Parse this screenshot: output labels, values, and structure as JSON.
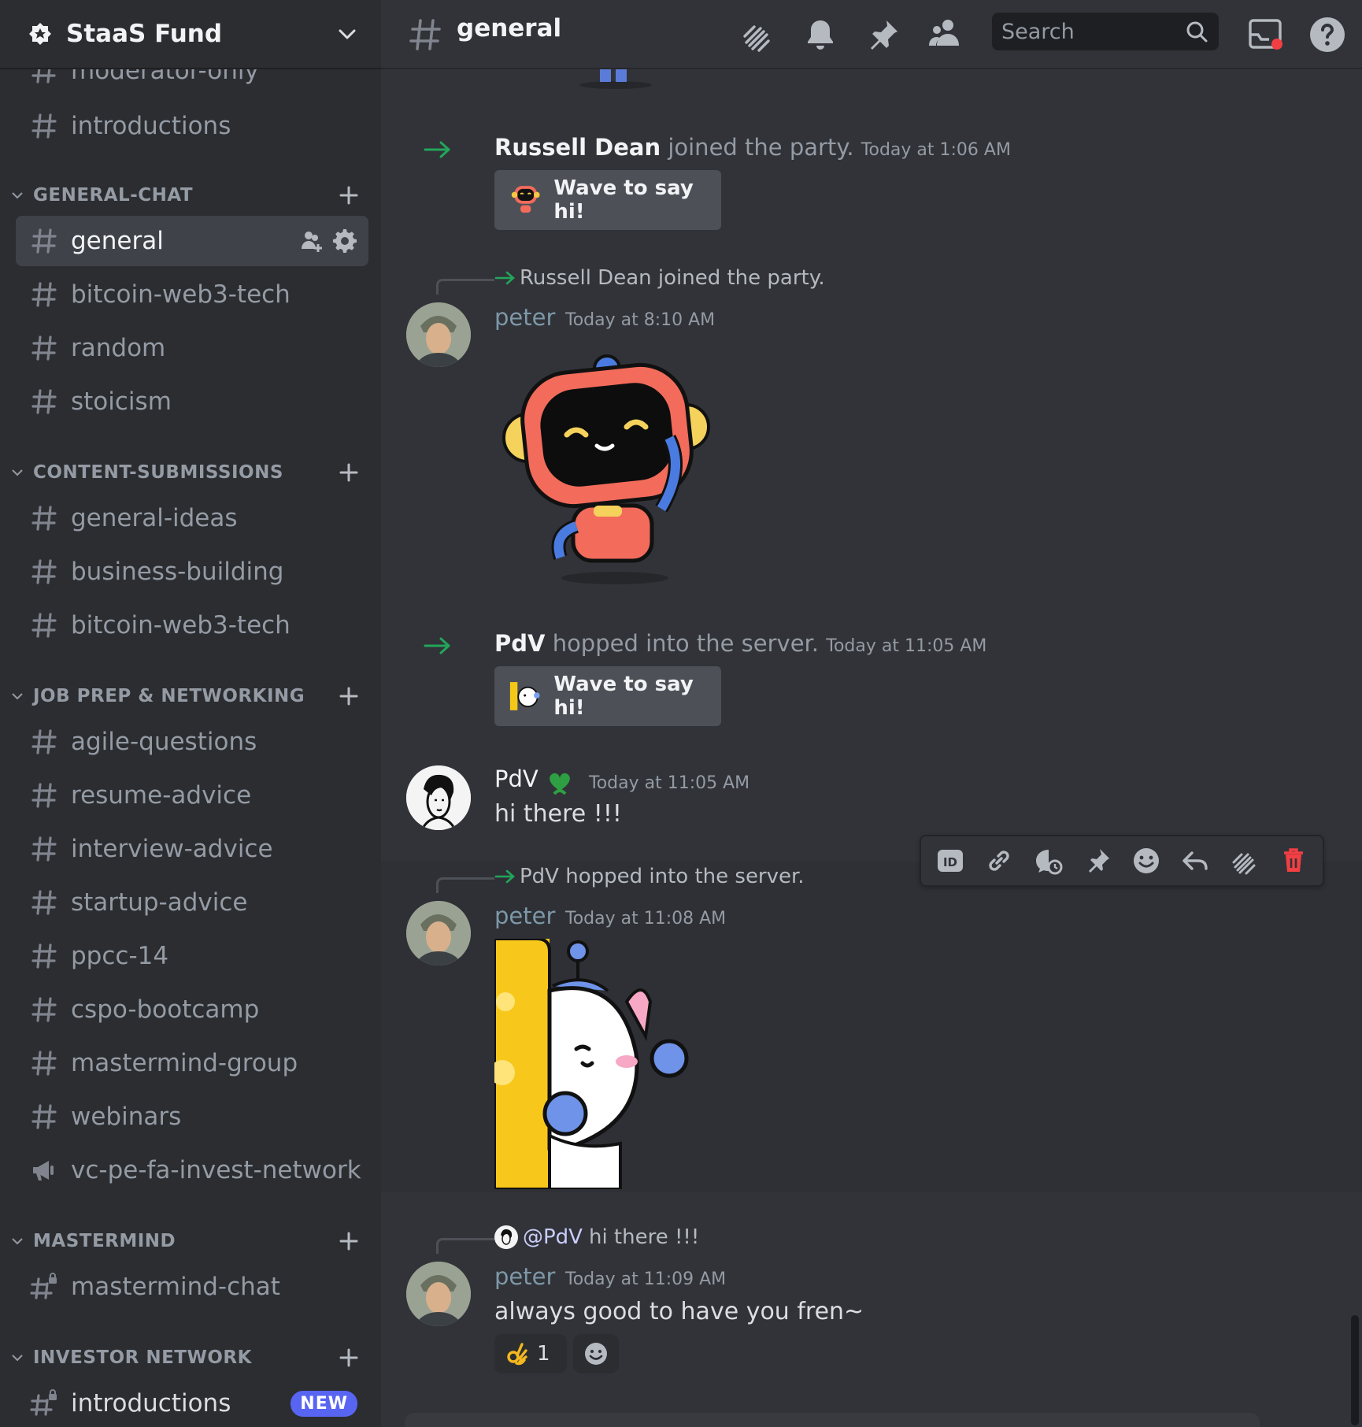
{
  "server": {
    "name": "StaaS Fund"
  },
  "sidebar": {
    "top_channels": [
      {
        "name": "moderator-only"
      },
      {
        "name": "introductions"
      }
    ],
    "categories": [
      {
        "title": "GENERAL-CHAT",
        "channels": [
          {
            "name": "general",
            "active": true
          },
          {
            "name": "bitcoin-web3-tech"
          },
          {
            "name": "random"
          },
          {
            "name": "stoicism"
          }
        ]
      },
      {
        "title": "CONTENT-SUBMISSIONS",
        "channels": [
          {
            "name": "general-ideas"
          },
          {
            "name": "business-building"
          },
          {
            "name": "bitcoin-web3-tech"
          }
        ]
      },
      {
        "title": "JOB PREP & NETWORKING",
        "channels": [
          {
            "name": "agile-questions"
          },
          {
            "name": "resume-advice"
          },
          {
            "name": "interview-advice"
          },
          {
            "name": "startup-advice"
          },
          {
            "name": "ppcc-14"
          },
          {
            "name": "cspo-bootcamp"
          },
          {
            "name": "mastermind-group"
          },
          {
            "name": "webinars"
          },
          {
            "name": "vc-pe-fa-invest-network",
            "type": "announcement"
          }
        ]
      },
      {
        "title": "MASTERMIND",
        "channels": [
          {
            "name": "mastermind-chat",
            "type": "locked"
          }
        ]
      },
      {
        "title": "INVESTOR NETWORK",
        "channels": [
          {
            "name": "introductions",
            "type": "locked",
            "badge": "NEW"
          }
        ]
      }
    ]
  },
  "topbar": {
    "channel": "general",
    "search_placeholder": "Search",
    "icons": [
      "threads-icon",
      "bell-icon",
      "pin-icon",
      "members-icon",
      "search-icon",
      "inbox-icon",
      "help-icon"
    ]
  },
  "messages": {
    "join1": {
      "who": "Russell Dean",
      "action": "joined the party.",
      "time": "Today at 1:06 AM",
      "wave": "Wave to say hi!"
    },
    "peter1": {
      "reply_ref": "Russell Dean joined the party.",
      "author": "peter",
      "time": "Today at 8:10 AM"
    },
    "join2": {
      "who": "PdV",
      "action": "hopped into the server.",
      "time": "Today at 11:05 AM",
      "wave": "Wave to say hi!"
    },
    "pdv1": {
      "author": "PdV",
      "time": "Today at 11:05 AM",
      "text": "hi there !!!"
    },
    "peter2": {
      "reply_ref": "PdV hopped into the server.",
      "author": "peter",
      "time": "Today at 11:08 AM"
    },
    "peter3": {
      "reply_mention": "@PdV",
      "reply_ref": "hi there !!!",
      "author": "peter",
      "time": "Today at 11:09 AM",
      "text": "always good to have you fren~"
    }
  },
  "reactions": [
    {
      "emoji": "ok-hand",
      "count": "1"
    }
  ],
  "colors": {
    "sidebar_bg": "#2b2d31",
    "main_bg": "#313338",
    "peter_name": "#7d98a8",
    "join_arrow": "#23a55a",
    "danger": "#f23f43",
    "accent": "#5865f2"
  }
}
